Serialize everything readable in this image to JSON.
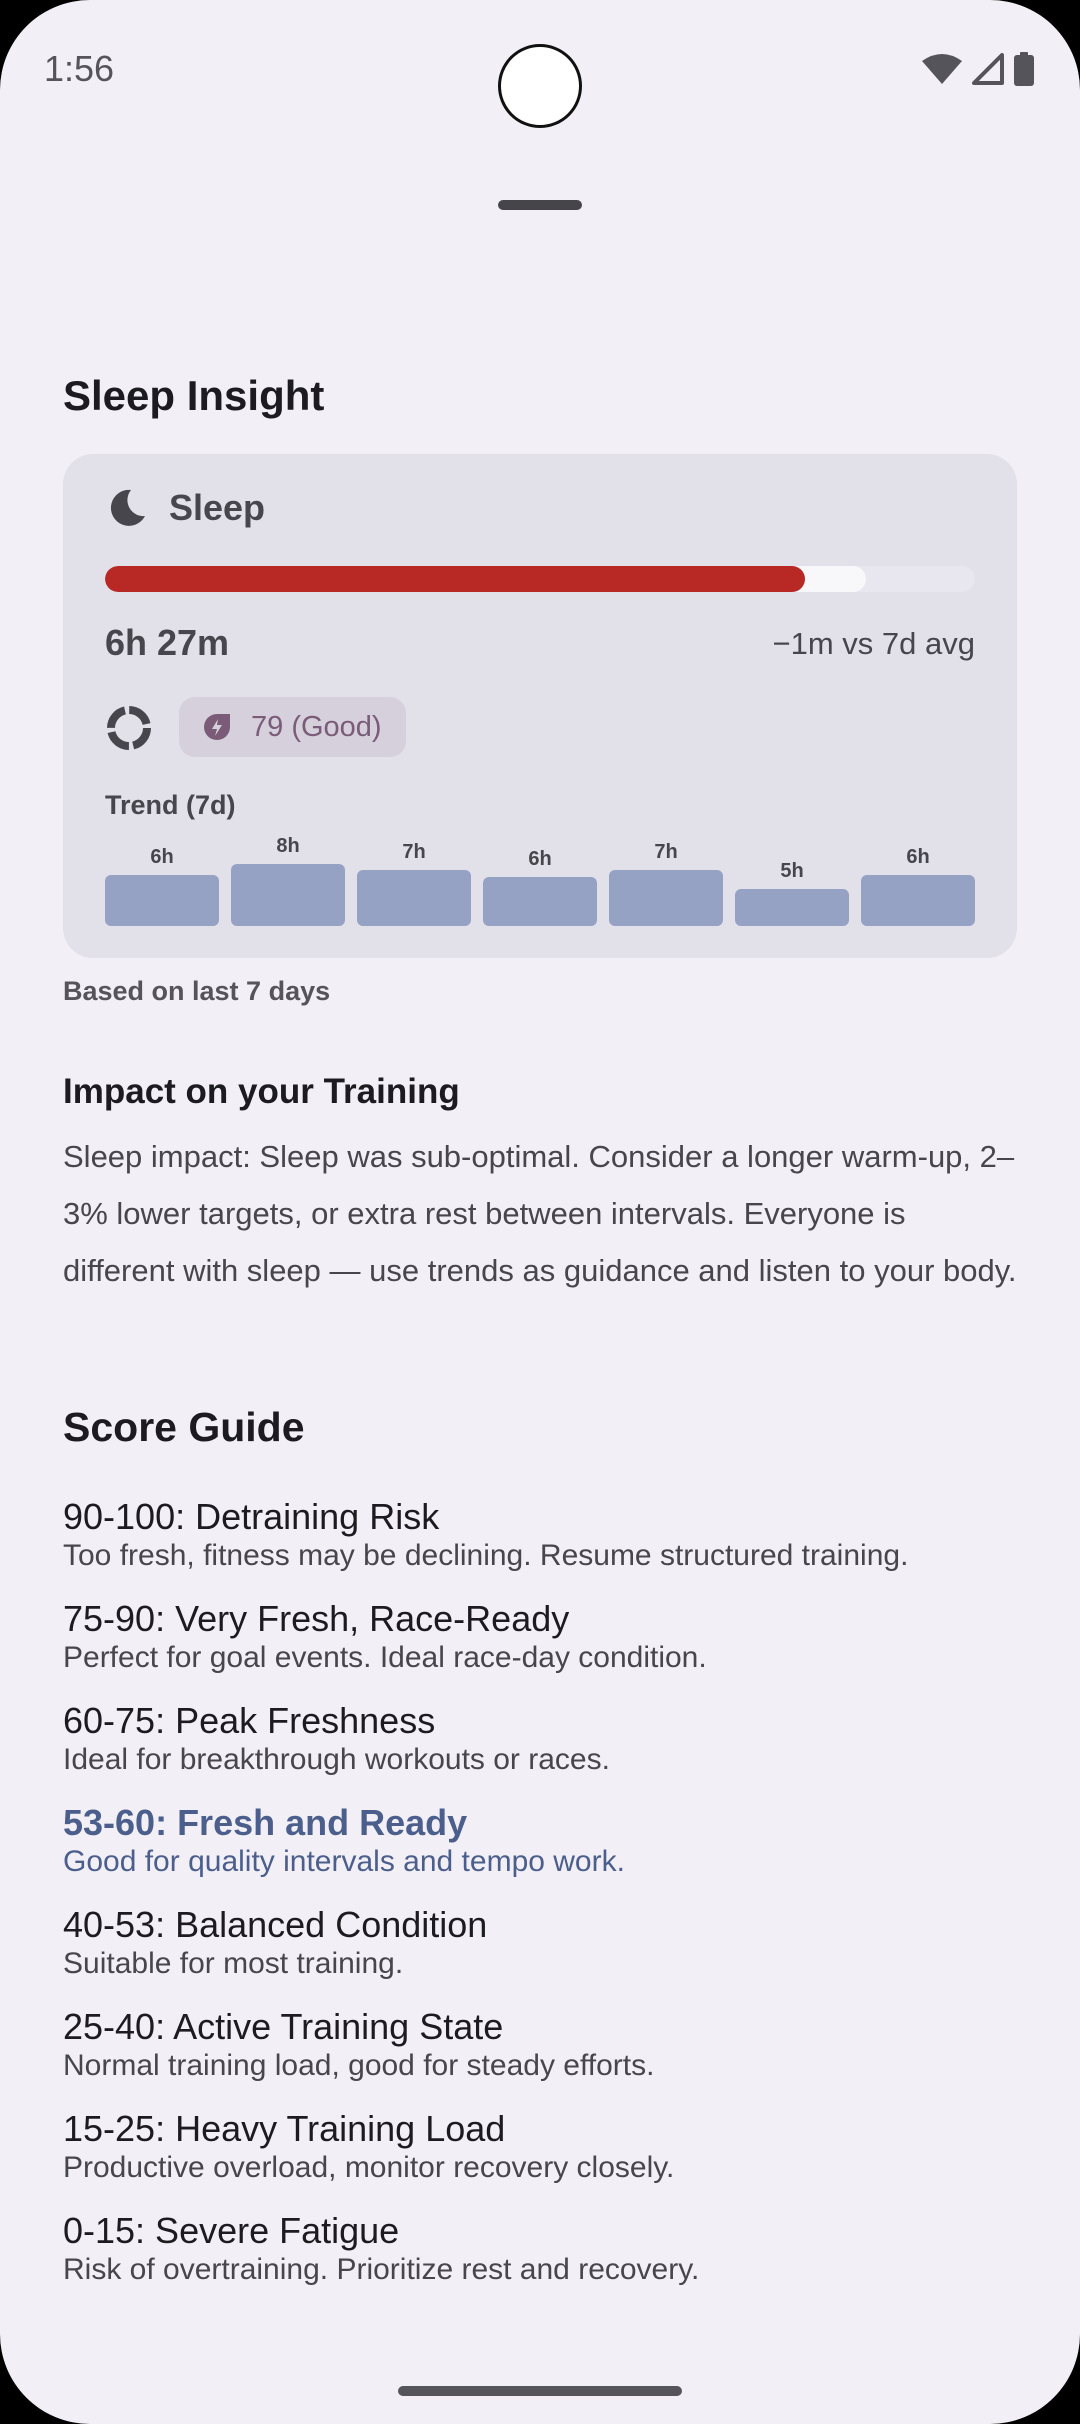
{
  "status_bar": {
    "time": "1:56"
  },
  "page_title": "Sleep Insight",
  "sleep_card": {
    "label": "Sleep",
    "progress_fraction": 0.805,
    "secondary_progress_fraction": 0.875,
    "duration": "6h 27m",
    "delta": "−1m vs 7d avg",
    "score_chip": "79 (Good)",
    "trend_label": "Trend (7d)",
    "trend": [
      {
        "label": "6h",
        "hours": 6.0
      },
      {
        "label": "8h",
        "hours": 7.3
      },
      {
        "label": "7h",
        "hours": 6.6
      },
      {
        "label": "6h",
        "hours": 5.8
      },
      {
        "label": "7h",
        "hours": 6.6
      },
      {
        "label": "5h",
        "hours": 4.3
      },
      {
        "label": "6h",
        "hours": 6.0
      }
    ],
    "colors": {
      "progress": "#b82824",
      "bars": "#96a2c4",
      "chip_bg": "#d6d0dc"
    }
  },
  "based_on": "Based on last 7 days",
  "impact": {
    "title": "Impact on your Training",
    "body": "Sleep impact: Sleep was sub-optimal. Consider a longer warm-up, 2–3% lower targets, or extra rest between intervals. Everyone is different with sleep — use trends as guidance and listen to your body."
  },
  "score_guide": {
    "title": "Score Guide",
    "items": [
      {
        "heading": "90-100: Detraining Risk",
        "description": "Too fresh, fitness may be declining. Resume structured training."
      },
      {
        "heading": "75-90: Very Fresh, Race-Ready",
        "description": "Perfect for goal events. Ideal race-day condition."
      },
      {
        "heading": "60-75: Peak Freshness",
        "description": "Ideal for breakthrough workouts or races."
      },
      {
        "heading": "53-60: Fresh and Ready",
        "description": "Good for quality intervals and tempo work.",
        "highlighted": true
      },
      {
        "heading": "40-53: Balanced Condition",
        "description": "Suitable for most training."
      },
      {
        "heading": "25-40: Active Training State",
        "description": "Normal training load, good for steady efforts."
      },
      {
        "heading": "15-25: Heavy Training Load",
        "description": "Productive overload, monitor recovery closely."
      },
      {
        "heading": "0-15: Severe Fatigue",
        "description": "Risk of overtraining. Prioritize rest and recovery."
      }
    ]
  }
}
